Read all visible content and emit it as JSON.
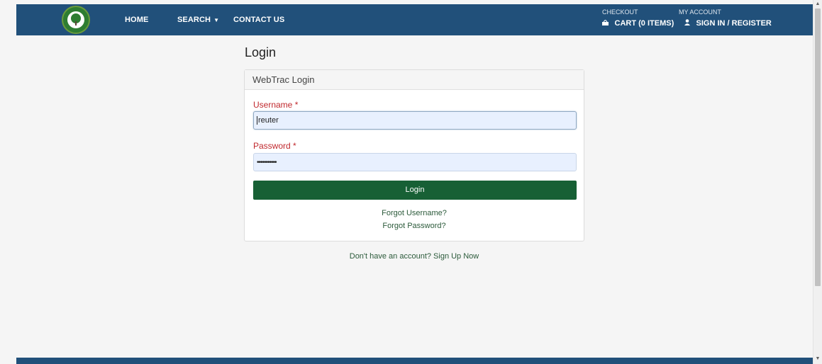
{
  "logo": {
    "icon": "park-district-logo"
  },
  "nav": {
    "home": "HOME",
    "search": "SEARCH",
    "contact": "CONTACT US"
  },
  "account": {
    "checkout_label": "CHECKOUT",
    "cart": "CART (0 ITEMS)",
    "my_account_label": "MY ACCOUNT",
    "signin": "SIGN IN / REGISTER"
  },
  "page": {
    "title": "Login"
  },
  "panel": {
    "header": "WebTrac Login",
    "username_label": "Username *",
    "username_value": "reuter",
    "password_label": "Password *",
    "password_value": "•••••••••••",
    "login_button": "Login",
    "forgot_username": "Forgot Username?",
    "forgot_password": "Forgot Password?"
  },
  "signup": "Don't have an account? Sign Up Now",
  "colors": {
    "header_bg": "#21507a",
    "button_bg": "#176035",
    "required_label": "#c0282d"
  }
}
